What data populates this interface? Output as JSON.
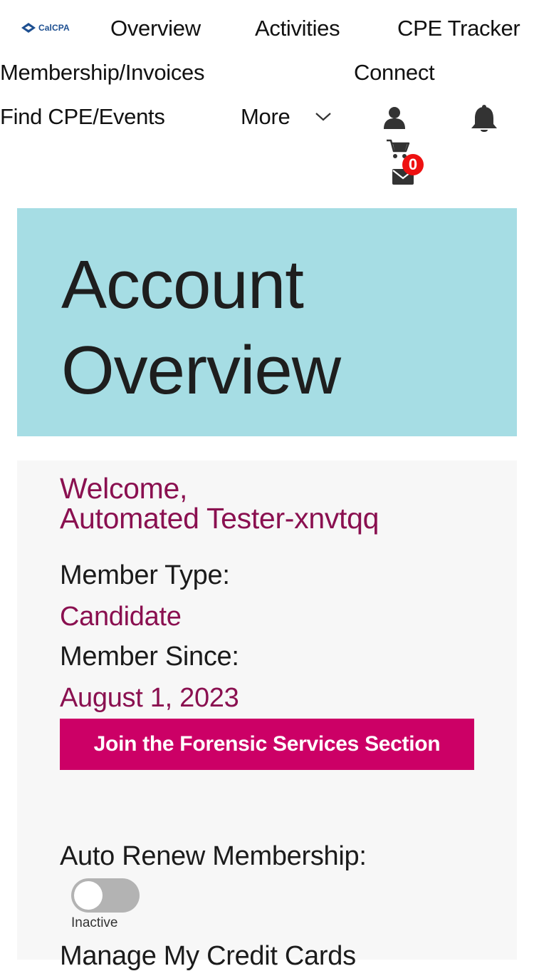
{
  "nav": {
    "logo_text": "CalCPA",
    "links": {
      "overview": "Overview",
      "activities": "Activities",
      "cpe_tracker": "CPE Tracker",
      "membership_invoices": "Membership/Invoices",
      "connect": "Connect",
      "find_cpe_events": "Find CPE/Events",
      "more": "More"
    },
    "icons": {
      "account": "user-icon",
      "notifications": "bell-icon",
      "cart": "cart-icon",
      "messages": "mail-icon"
    },
    "cart_count": "0"
  },
  "hero": {
    "title_line1": "Account",
    "title_line2": "Overview"
  },
  "account": {
    "welcome_line1": "Welcome,",
    "welcome_line2": "Automated Tester-xnvtqq",
    "member_type_label": "Member Type:",
    "member_type_value": "Candidate",
    "member_since_label": "Member Since:",
    "member_since_value": "August 1, 2023",
    "join_button_label": "Join the Forensic Services Section",
    "auto_renew_label": "Auto Renew Membership:",
    "auto_renew_status": "Inactive",
    "auto_renew_on": false,
    "credit_cards_link": "Manage My Credit Cards"
  },
  "colors": {
    "hero_bg": "#a6dde4",
    "accent_text": "#8a1050",
    "button_bg": "#cc0066",
    "badge_bg": "#ee1111",
    "logo_blue": "#1d4f91"
  }
}
